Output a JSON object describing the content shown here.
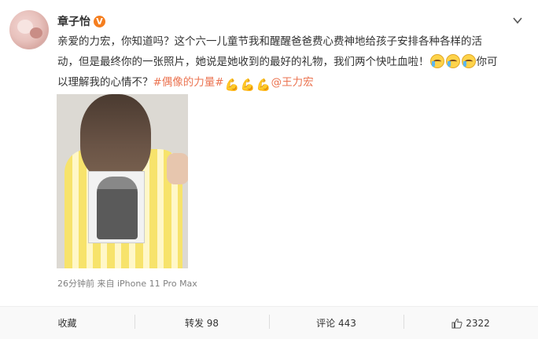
{
  "post": {
    "author": "章子怡",
    "verified_badge": "V",
    "text": {
      "line1": "亲爱的力宏，你知道吗？这个六一儿童节我和醒醒爸爸费心费神地给孩子安排各种各样的活",
      "line2_prefix": "动，但是最终你的一张照片，她说是她收到的最好的礼物，我们两个快吐血啦！",
      "line2_suffix": "你可",
      "line3_prefix": "以理解我的心情不？",
      "topic": "#偶像的力量#",
      "mention": "@王力宏"
    },
    "emojis": {
      "cry": "crying-laughing-icon",
      "arm": "flexed-biceps-icon"
    },
    "time": "26分钟前",
    "source": "来自 iPhone 11 Pro Max"
  },
  "actions": {
    "favorite_label": "收藏",
    "repost_label": "转发 98",
    "comment_label": "评论 443",
    "like_count": "2322"
  },
  "colors": {
    "link": "#eb7350",
    "verified": "#f57e1f",
    "meta": "#808080"
  }
}
